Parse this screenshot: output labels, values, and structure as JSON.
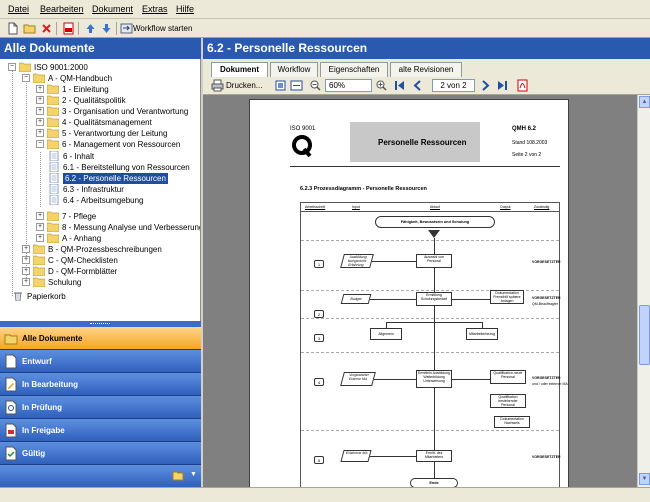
{
  "menu": [
    "Datei",
    "Bearbeiten",
    "Dokument",
    "Extras",
    "Hilfe"
  ],
  "toolbar": {
    "workflow_label": "Workflow starten"
  },
  "left_panel": {
    "title": "Alle Dokumente"
  },
  "tree": {
    "root": "ISO 9001:2000",
    "handbook": "A - QM-Handbuch",
    "chapters": [
      "1 - Einleitung",
      "2 - Qualitätspolitik",
      "3 - Organisation und Verantwortung",
      "4 - Qualitätsmanagement",
      "5 - Verantwortung der Leitung",
      "6 - Management von Ressourcen"
    ],
    "sub": [
      "6 - Inhalt",
      "6.1 - Bereitstellung von Ressourcen",
      "6.2 - Personelle Ressourcen",
      "6.3 - Infrastruktur",
      "6.4 - Arbeitsumgebung"
    ],
    "after": [
      "7 - Pflege",
      "8 - Messung Analyse und Verbesserung",
      "A - Anhang"
    ],
    "top_level": [
      "B - QM-Prozessbeschreibungen",
      "C - QM-Checklisten",
      "D - QM-Formblätter",
      "Schulung"
    ],
    "trash": "Papierkorb"
  },
  "nav_buttons": [
    "Alle Dokumente",
    "Entwurf",
    "In Bearbeitung",
    "In Prüfung",
    "In Freigabe",
    "Gültig"
  ],
  "right_panel": {
    "title": "6.2 - Personelle Ressourcen"
  },
  "tabs": [
    "Dokument",
    "Workflow",
    "Eigenschaften",
    "alte Revisionen"
  ],
  "doc_toolbar": {
    "print_label": "Drucken...",
    "zoom": "60%",
    "page": "2 von 2"
  },
  "document": {
    "iso_label": "ISO 9001",
    "title": "Personelle Ressourcen",
    "doc_id": "QMH 6.2",
    "stand": "Stand 108.2003",
    "seite": "Seite 2 von 2",
    "section": "6.2.3    Prozessdiagramm - Personelle Ressourcen",
    "columns": [
      "Arbeitsschritt",
      "Input",
      "Ablauf",
      "Output",
      "Zuständig"
    ],
    "banner": "Fähigkeit, Bewusstsein und Schulung",
    "steps": [
      "1",
      "2",
      "3",
      "4",
      "5"
    ],
    "boxes": {
      "b1": "Ausbildung fachgerecht Erfahrung",
      "b1r": "Auswahl von Personal",
      "b2": "Budget",
      "b2c": "Ermittlung Schulungsbedarf",
      "b2o": "Dokumentation Fremdhilf spätere Anlagen",
      "b3a": "Allgemein",
      "b3b": "Mitarbeiterbezug",
      "b4": "Vorgesetzter Externe MA",
      "b4c": "Ermitteln Ausbildung Weiterbildung Unterweisung",
      "b4o1": "Qualifikation neuer Personal",
      "b4o2": "Qualifikation bestehender Personal",
      "b4o3": "Dokumentation Nachweis",
      "b5": "Erfahrene MA",
      "b5c": "Ermitt. des Mitarbeiters",
      "end": "Ende"
    },
    "roles": {
      "r1": "VORGESETZTER",
      "r2": "VORGESETZTER",
      "r2s": "QM-Beauftragter",
      "r4": "VORGESETZTER",
      "r4s": "und / oder externer MA",
      "r5": "VORGESETZTER"
    }
  },
  "colors": {
    "header_blue": "#2a5ab0",
    "nav_active": "#f5a623",
    "selection": "#1f4e9e"
  }
}
